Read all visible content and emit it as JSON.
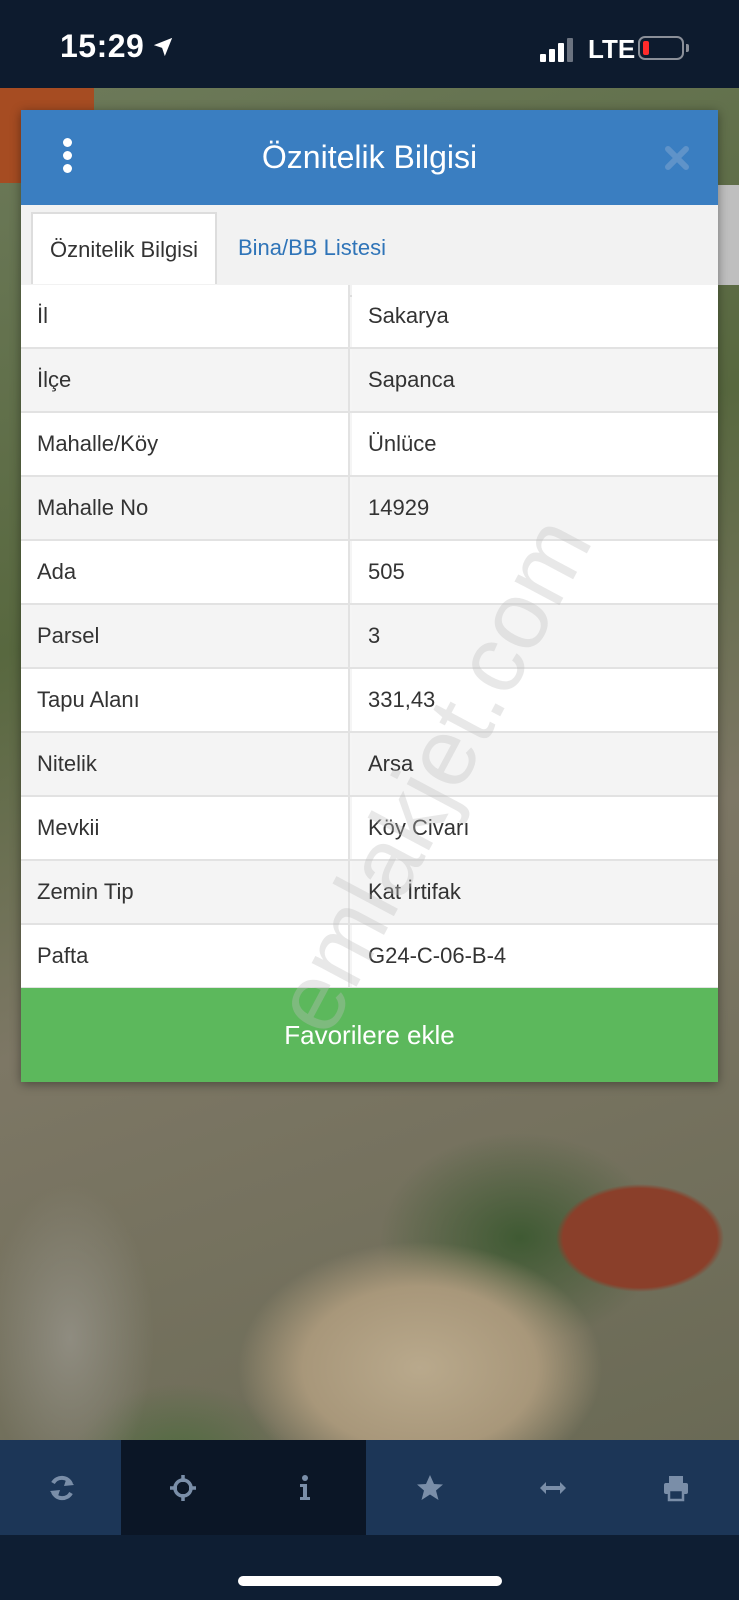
{
  "status_bar": {
    "time": "15:29",
    "network": "LTE"
  },
  "dialog": {
    "title": "Öznitelik Bilgisi",
    "tabs": [
      {
        "label": "Öznitelik Bilgisi",
        "active": true
      },
      {
        "label": "Bina/BB Listesi",
        "active": false
      }
    ],
    "rows": [
      {
        "key": "İl",
        "value": "Sakarya"
      },
      {
        "key": "İlçe",
        "value": "Sapanca"
      },
      {
        "key": "Mahalle/Köy",
        "value": "Ünlüce"
      },
      {
        "key": "Mahalle No",
        "value": "14929"
      },
      {
        "key": "Ada",
        "value": "505"
      },
      {
        "key": "Parsel",
        "value": "3"
      },
      {
        "key": "Tapu Alanı",
        "value": "331,43"
      },
      {
        "key": "Nitelik",
        "value": "Arsa"
      },
      {
        "key": "Mevkii",
        "value": "Köy Civarı"
      },
      {
        "key": "Zemin Tip",
        "value": "Kat İrtifak"
      },
      {
        "key": "Pafta",
        "value": "G24-C-06-B-4"
      }
    ],
    "favorite_button": "Favorilere ekle"
  },
  "watermark": "emlakjet.com",
  "toolbar": [
    {
      "icon": "refresh-icon",
      "active": false
    },
    {
      "icon": "crosshair-icon",
      "active": true
    },
    {
      "icon": "info-icon",
      "active": true
    },
    {
      "icon": "star-icon",
      "active": false
    },
    {
      "icon": "measure-icon",
      "active": false
    },
    {
      "icon": "print-icon",
      "active": false
    }
  ],
  "colors": {
    "header": "#3a7ec1",
    "favorite_button": "#5cb85c",
    "toolbar": "#1c3657",
    "toolbar_active": "#0b1626",
    "tab_link": "#2f74b8"
  }
}
